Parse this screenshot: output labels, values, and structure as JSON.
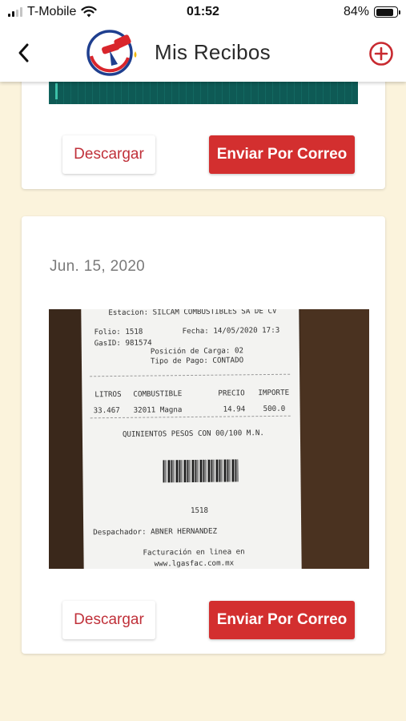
{
  "status_bar": {
    "carrier": "T-Mobile",
    "time": "01:52",
    "battery_percent": "84%",
    "battery_level": 0.84
  },
  "header": {
    "title": "Mis Recibos",
    "back_icon": "chevron-left-icon",
    "add_icon": "plus-circle-icon",
    "accent_color": "#d32f2f"
  },
  "receipts": [
    {
      "download_label": "Descargar",
      "email_label": "Enviar Por Correo"
    },
    {
      "date": "Jun. 15, 2020",
      "download_label": "Descargar",
      "email_label": "Enviar Por Correo",
      "ticket": {
        "station": "Estacion: SILCAM COMBUSTIBLES SA DE CV",
        "folio": "Folio: 1518",
        "fecha": "Fecha: 14/05/2020 17:3",
        "gasid": "GasID: 981574",
        "posicion": "Posición de Carga: 02",
        "tipo_pago": "Tipo de Pago: CONTADO",
        "col_litros": "LITROS",
        "col_combustible": "COMBUSTIBLE",
        "col_precio": "PRECIO",
        "col_importe": "IMPORTE",
        "row_litros": "33.467",
        "row_combustible": "32011  Magna",
        "row_precio": "14.94",
        "row_importe": "500.0",
        "amount_text": "QUINIENTOS PESOS CON 00/100 M.N.",
        "barcode_number": "1518",
        "despachador": "Despachador: ABNER HERNANDEZ",
        "facturacion": "Facturación en linea en",
        "website": "www.lgasfac.com.mx"
      }
    }
  ]
}
